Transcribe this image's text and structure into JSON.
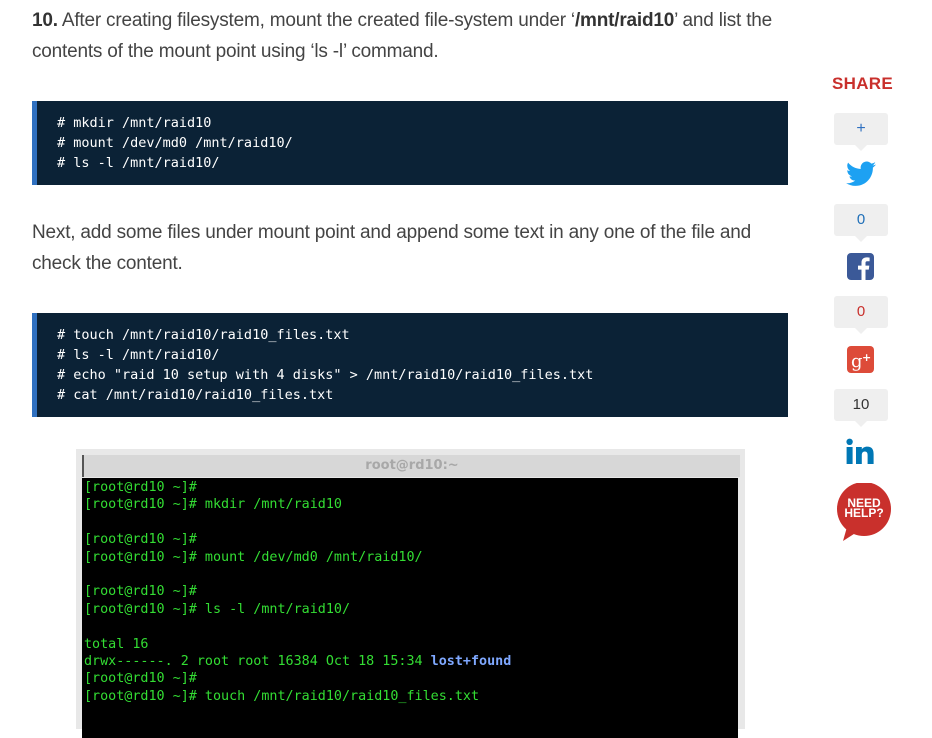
{
  "step_para": {
    "number": "10.",
    "text_before": " After creating filesystem, mount the created file-system under ‘",
    "path": "/mnt/raid10",
    "text_after": "’ and list the contents of the mount point using ‘ls -l’ command."
  },
  "code_block_1": {
    "lines": [
      "# mkdir /mnt/raid10",
      "# mount /dev/md0 /mnt/raid10/",
      "# ls -l /mnt/raid10/"
    ]
  },
  "next_para": "Next, add some files under mount point and append some text in any one of the file and check the content.",
  "code_block_2": {
    "lines": [
      "# touch /mnt/raid10/raid10_files.txt",
      "# ls -l /mnt/raid10/",
      "# echo \"raid 10 setup with 4 disks\" > /mnt/raid10/raid10_files.txt",
      "# cat /mnt/raid10/raid10_files.txt"
    ]
  },
  "terminal": {
    "title": "root@rd10:~",
    "lines": [
      "[root@rd10 ~]#",
      "[root@rd10 ~]# mkdir /mnt/raid10",
      "",
      "[root@rd10 ~]#",
      "[root@rd10 ~]# mount /dev/md0 /mnt/raid10/",
      "",
      "[root@rd10 ~]#",
      "[root@rd10 ~]# ls -l /mnt/raid10/",
      "",
      "total 16",
      "drwx------. 2 root root 16384 Oct 18 15:34 ",
      "[root@rd10 ~]#",
      "[root@rd10 ~]# touch /mnt/raid10/raid10_files.txt"
    ],
    "dir_name": "lost+found"
  },
  "share": {
    "title": "SHARE",
    "plus_count": "+",
    "twitter_count": "0",
    "facebook_count": "0",
    "googleplus_count": "10",
    "need_help": [
      "NEED",
      "HELP?"
    ]
  },
  "colors": {
    "share_red": "#c9302c",
    "twitter": "#1da1f2",
    "facebook": "#3b5998",
    "googleplus": "#dd4b39",
    "linkedin": "#0077b5",
    "code_bg": "#0b2236",
    "terminal_green": "#33dd33"
  }
}
